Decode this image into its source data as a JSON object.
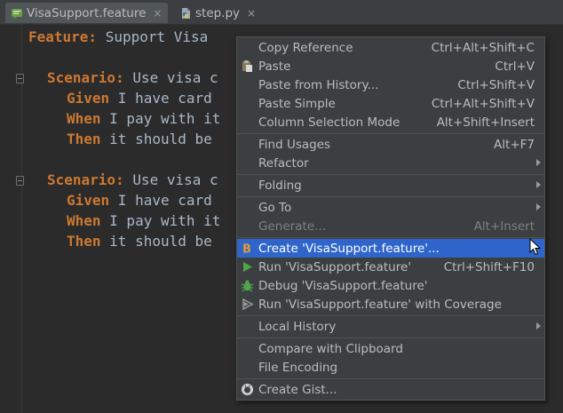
{
  "tabs": [
    {
      "label": "VisaSupport.feature",
      "close": "×",
      "icon": "feature-file-icon"
    },
    {
      "label": "step.py",
      "close": "×",
      "icon": "python-file-icon"
    }
  ],
  "code": {
    "line1": {
      "keyword": "Feature:",
      "text": " Support Visa"
    },
    "s1_scenario": {
      "keyword": "Scenario:",
      "text": " Use visa c"
    },
    "s1_given": {
      "keyword": "Given",
      "text": " I have card"
    },
    "s1_when": {
      "keyword": "When",
      "text": " I pay with it"
    },
    "s1_then": {
      "keyword": "Then",
      "text": " it should be"
    },
    "s2_scenario": {
      "keyword": "Scenario:",
      "text": " Use visa c"
    },
    "s2_given": {
      "keyword": "Given",
      "text": " I have card"
    },
    "s2_when": {
      "keyword": "When",
      "text": " I pay with it"
    },
    "s2_then": {
      "keyword": "Then",
      "text": " it should be"
    }
  },
  "menu": {
    "copy_reference": {
      "label": "Copy Reference",
      "shortcut": "Ctrl+Alt+Shift+C"
    },
    "paste": {
      "label": "Paste",
      "shortcut": "Ctrl+V",
      "icon": "paste-icon"
    },
    "paste_history": {
      "label": "Paste from History...",
      "shortcut": "Ctrl+Shift+V"
    },
    "paste_simple": {
      "label": "Paste Simple",
      "shortcut": "Ctrl+Alt+Shift+V"
    },
    "column_selection": {
      "label": "Column Selection Mode",
      "shortcut": "Alt+Shift+Insert"
    },
    "find_usages": {
      "label": "Find Usages",
      "shortcut": "Alt+F7"
    },
    "refactor": {
      "label": "Refactor"
    },
    "folding": {
      "label": "Folding"
    },
    "go_to": {
      "label": "Go To"
    },
    "generate": {
      "label": "Generate...",
      "shortcut": "Alt+Insert"
    },
    "create": {
      "label": "Create 'VisaSupport.feature'...",
      "icon": "behave-icon",
      "icon_text": "B"
    },
    "run": {
      "label": "Run 'VisaSupport.feature'",
      "shortcut": "Ctrl+Shift+F10",
      "icon": "run-icon"
    },
    "debug": {
      "label": "Debug 'VisaSupport.feature'",
      "icon": "debug-icon"
    },
    "run_coverage": {
      "label": "Run 'VisaSupport.feature' with Coverage",
      "icon": "coverage-icon"
    },
    "local_history": {
      "label": "Local History"
    },
    "compare_clipboard": {
      "label": "Compare with Clipboard"
    },
    "file_encoding": {
      "label": "File Encoding"
    },
    "create_gist": {
      "label": "Create Gist...",
      "icon": "github-icon"
    }
  },
  "colors": {
    "keyword": "#cc7832",
    "text": "#a9b7c6",
    "selection": "#2f65ca",
    "menu_bg": "#3c3f41",
    "editor_bg": "#2b2b2b"
  }
}
